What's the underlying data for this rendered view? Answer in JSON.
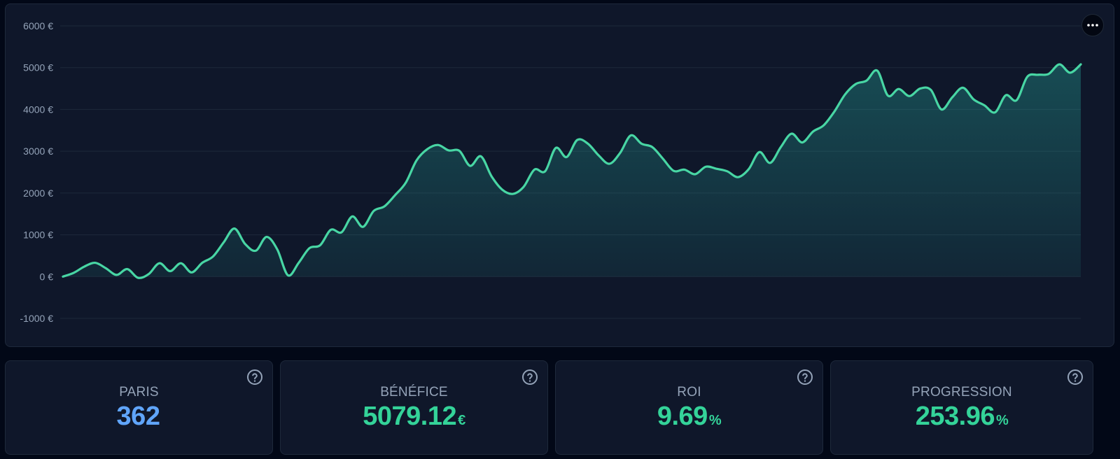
{
  "chart_data": {
    "type": "area",
    "ylabel": "",
    "xlabel": "",
    "ylim": [
      -1000,
      6000
    ],
    "y_ticks": [
      "6000 €",
      "5000 €",
      "4000 €",
      "3000 €",
      "2000 €",
      "1000 €",
      "0 €",
      "-1000 €"
    ],
    "y_tick_values": [
      6000,
      5000,
      4000,
      3000,
      2000,
      1000,
      0,
      -1000
    ],
    "grid": true,
    "series": [
      {
        "values": [
          0,
          90,
          240,
          330,
          200,
          40,
          180,
          -30,
          60,
          320,
          130,
          320,
          100,
          330,
          480,
          820,
          1150,
          780,
          620,
          950,
          650,
          30,
          330,
          680,
          750,
          1120,
          1060,
          1440,
          1190,
          1570,
          1680,
          1950,
          2250,
          2780,
          3050,
          3150,
          3020,
          3010,
          2650,
          2880,
          2400,
          2080,
          1980,
          2150,
          2560,
          2520,
          3080,
          2860,
          3270,
          3180,
          2900,
          2700,
          2960,
          3380,
          3180,
          3100,
          2820,
          2530,
          2560,
          2450,
          2630,
          2580,
          2520,
          2380,
          2570,
          2980,
          2720,
          3100,
          3420,
          3210,
          3470,
          3620,
          3950,
          4360,
          4610,
          4690,
          4930,
          4330,
          4490,
          4320,
          4500,
          4470,
          4000,
          4290,
          4520,
          4240,
          4100,
          3930,
          4340,
          4220,
          4780,
          4830,
          4850,
          5080,
          4880,
          5079.12
        ]
      }
    ],
    "line_color": "#48d6a4",
    "fill_color": "#2dd4bf"
  },
  "menu": {
    "icon": "more-dots-icon"
  },
  "stats": [
    {
      "label": "PARIS",
      "value": "362",
      "unit": "",
      "color": "#60a5fa",
      "icon": "help-circle-icon"
    },
    {
      "label": "BÉNÉFICE",
      "value": "5079.12",
      "unit": "€",
      "color": "#34d399",
      "icon": "help-circle-icon"
    },
    {
      "label": "ROI",
      "value": "9.69",
      "unit": "%",
      "color": "#34d399",
      "icon": "help-circle-icon"
    },
    {
      "label": "PROGRESSION",
      "value": "253.96",
      "unit": "%",
      "color": "#34d399",
      "icon": "help-circle-icon"
    }
  ]
}
